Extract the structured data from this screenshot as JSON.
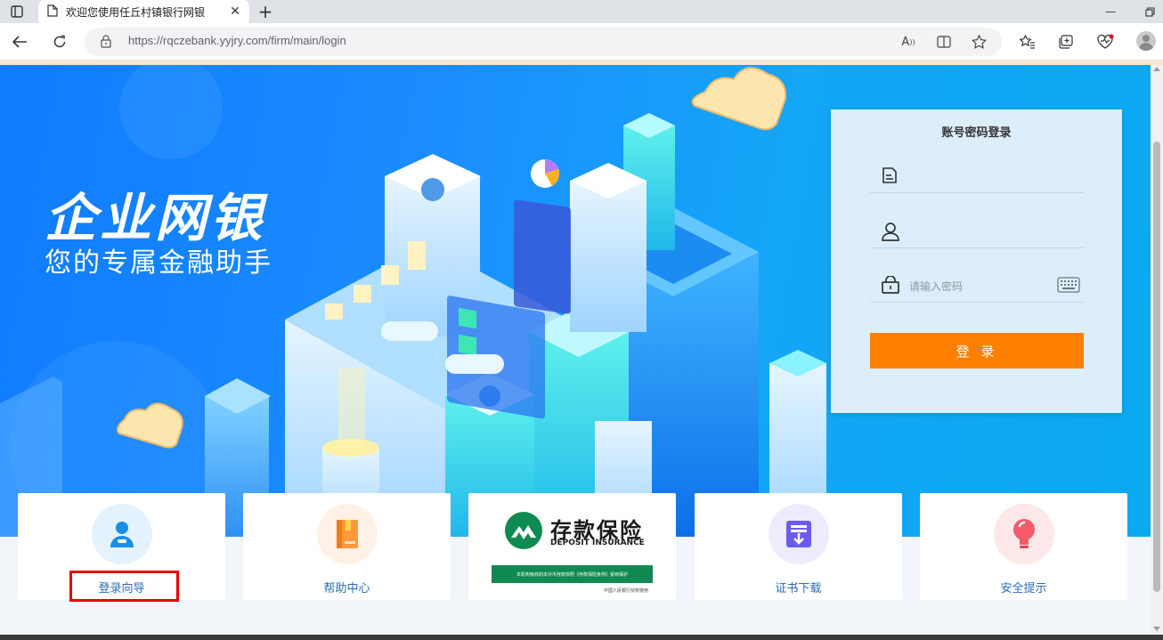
{
  "browser": {
    "tab_title": "欢迎您使用任丘村镇银行网银",
    "url": "https://rqczebank.yyjry.com/firm/main/login",
    "icons": [
      "tab-actions-icon",
      "page-icon",
      "close-icon",
      "new-tab-icon",
      "minimize-icon",
      "restore-icon",
      "back-icon",
      "refresh-icon",
      "lock-icon",
      "read-aloud-icon",
      "split-screen-icon",
      "favorite-star-icon",
      "favorites-icon",
      "collections-icon",
      "browser-essentials-icon",
      "profile-avatar"
    ]
  },
  "hero": {
    "title": "企业网银",
    "subtitle": "您的专属金融助手"
  },
  "login": {
    "title": "账号密码登录",
    "account_placeholder": "",
    "username_placeholder": "",
    "password_placeholder": "请输入密码",
    "button_label": "登 录"
  },
  "cards": {
    "guide_label": "登录向导",
    "help_label": "帮助中心",
    "insurance_title": "存款保险",
    "insurance_en": "DEPOSIT INSURANCE",
    "insurance_bar": "本机构吸收的本外币存款依照《存款保险条例》受到保护",
    "insurance_foot": "中国人民银行授权使用",
    "cert_label": "证书下载",
    "security_label": "安全提示"
  },
  "colors": {
    "hero_blue": "#1b8cff",
    "login_button": "#ff8000",
    "card_label": "#2a6bb5",
    "insurance_green": "#0f8a52",
    "highlight_red": "#e60000"
  }
}
